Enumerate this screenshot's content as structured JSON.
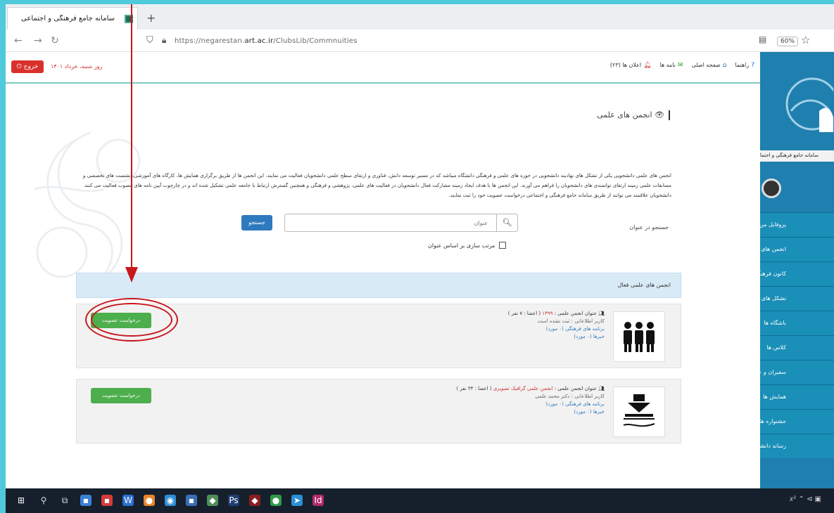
{
  "browser": {
    "tab_title": "سامانه جامع فرهنگی و اجتماعی",
    "tab_close": "×",
    "new_tab": "+",
    "url_prefix": "https://negarestan.",
    "url_domain": "art.ac.ir",
    "url_suffix": "/ClubsLib/Commnuities",
    "zoom": "60%"
  },
  "header": {
    "exit_label": "خروج",
    "user_date": "روز شنبه، خرداد ۱۴۰۱",
    "links": [
      "راهنما",
      "صفحه اصلی",
      "نامه ها",
      "اعلان ها (۲۳)"
    ]
  },
  "page": {
    "title": "انجمن های علمی",
    "intro": "انجمن های علمی دانشجویی یکی از تشکل های نهادینه دانشجویی در حوزه های علمی و فرهنگی دانشگاه میباشد که در مسیر توسعه دانش، فناوری و ارتقای سطح علمی دانشجویان فعالیت می نمایند. این انجمن ها از طریق برگزاری همایش ها، کارگاه های آموزشی، نشست های تخصصی و مسابقات علمی زمینه ارتقای توانمندی های دانشجویان را فراهم می آورند. این انجمن ها با هدف ایجاد زمینه مشارکت فعال دانشجویان در فعالیت های علمی، پژوهشی و فرهنگی و همچنین گسترش ارتباط با جامعه علمی تشکیل شده اند و در چارچوب آیین نامه های مصوب فعالیت می کنند. دانشجویان علاقمند می توانند از طریق سامانه جامع فرهنگی و اجتماعی درخواست عضویت خود را ثبت نمایند."
  },
  "search": {
    "label": "جستجو در عنوان",
    "placeholder": "عنوان",
    "button": "جستجو",
    "sort_label": "مرتب سازی بر اساس عنوان"
  },
  "list": {
    "header": "انجمن های علمی فعال",
    "items": [
      {
        "title_label": "عنوان انجمن علمی :",
        "title": "۱۳۹۹",
        "members": "( اعضا : ۷ نفر )",
        "manager": "کاربر اطلاعاتی : ثبت نشده است",
        "program": "برنامه های فرهنگی (۰ مورد)",
        "events": "خبرها (۰ مورد)",
        "button": "درخواست عضویت"
      },
      {
        "title_label": "عنوان انجمن علمی :",
        "title": "انجمن علمی گرافیک تصویری",
        "members": "( اعضا : ۳۴ نفر )",
        "manager": "کاربر اطلاعاتی : دکتر محمد علمی",
        "program": "برنامه های فرهنگی (۰ مورد)",
        "events": "خبرها (۰ مورد)",
        "button": "درخواست عضویت"
      }
    ]
  },
  "sidebar": {
    "brand": "سامانه جامع فرهنگی و اجتماعی نگارستان",
    "menu": [
      "پروفایل من",
      "انجمن های علمی",
      "کانون فرهنگی",
      "تشکل های اسلامی",
      "باشگاه ها",
      "کلاس ها",
      "سفیران و عترت",
      "همایش ها",
      "جشنواره ها",
      "رسانه دانشجویی"
    ]
  },
  "taskbar": {
    "tray": "𝑥² ⌃ ⊲ ▣"
  }
}
